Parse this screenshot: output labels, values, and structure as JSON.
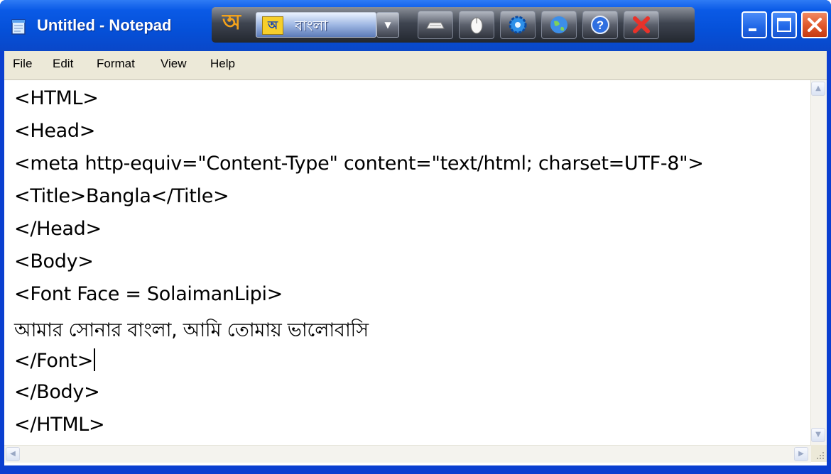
{
  "window": {
    "title": "Untitled - Notepad"
  },
  "ime_toolbar": {
    "logo_glyph": "অ",
    "layout_icon_glyph": "অ",
    "layout_name": "বাংলা",
    "buttons": [
      "keyboard-icon",
      "mouse-icon",
      "settings-icon",
      "globe-icon",
      "help-icon",
      "exit-icon"
    ]
  },
  "menu": {
    "items": [
      "File",
      "Edit",
      "Format",
      "View",
      "Help"
    ]
  },
  "editor": {
    "lines": [
      "<HTML>",
      "<Head>",
      "<meta http-equiv=\"Content-Type\" content=\"text/html; charset=UTF-8\">",
      "<Title>Bangla</Title>",
      "</Head>",
      "<Body>",
      "<Font Face = SolaimanLipi>",
      "আমার সোনার বাংলা, আমি তোমায় ভালোবাসি",
      "</Font>",
      "</Body>",
      "</HTML>"
    ],
    "caret_line": 8
  },
  "colors": {
    "titlebar": "#0550d8",
    "menubar": "#ece9d8",
    "close_button": "#e15a2e"
  }
}
